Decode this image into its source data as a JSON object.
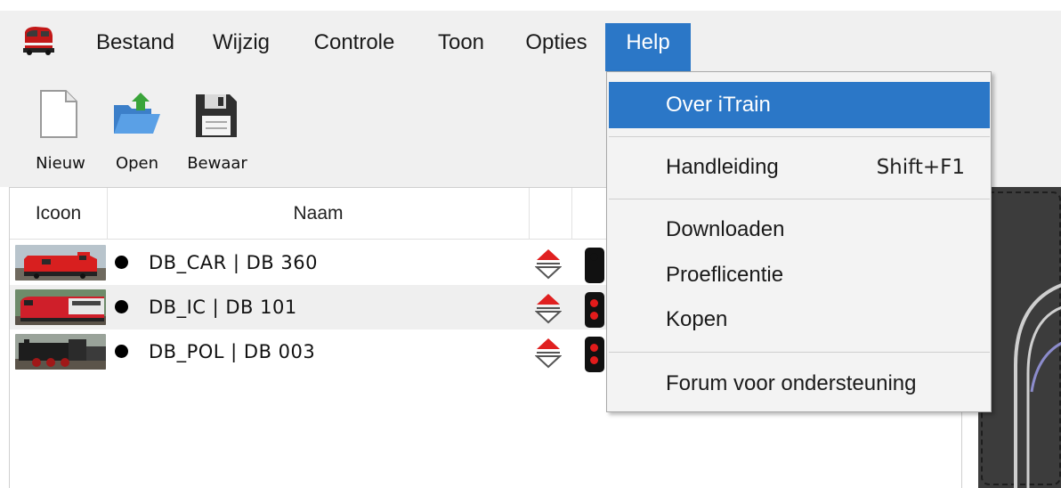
{
  "menubar": {
    "items": [
      {
        "label": "Bestand"
      },
      {
        "label": "Wijzig"
      },
      {
        "label": "Controle"
      },
      {
        "label": "Toon"
      },
      {
        "label": "Opties"
      },
      {
        "label": "Help"
      }
    ],
    "active_item": "Help"
  },
  "toolbar": {
    "new_label": "Nieuw",
    "open_label": "Open",
    "save_label": "Bewaar"
  },
  "table": {
    "headers": [
      "Icoon",
      "Naam",
      "",
      ""
    ],
    "rows": [
      {
        "name": "DB_CAR | DB 360"
      },
      {
        "name": "DB_IC | DB 101"
      },
      {
        "name": "DB_POL | DB 003"
      }
    ]
  },
  "help_menu": {
    "items": [
      {
        "label": "Over iTrain",
        "selected": true
      },
      {
        "label": "Handleiding",
        "shortcut": "Shift+F1"
      },
      {
        "label": "Downloaden"
      },
      {
        "label": "Proeflicentie"
      },
      {
        "label": "Kopen"
      },
      {
        "label": "Forum voor ondersteuning"
      }
    ]
  },
  "colors": {
    "accent": "#2b77c7",
    "menubar_bg": "#f0f0f0",
    "signal_red": "#e21b1b"
  }
}
